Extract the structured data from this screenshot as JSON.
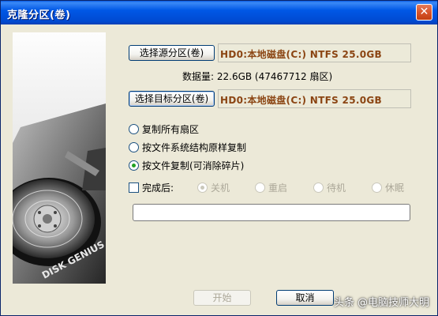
{
  "window": {
    "title": "克隆分区(卷)",
    "close_glyph": "✕"
  },
  "side_image": {
    "brand_text": "DISK GENIUS"
  },
  "source": {
    "button_label": "选择源分区(卷)",
    "drive": "HD0:本地磁盘(C:) NTFS 25.0GB"
  },
  "info": {
    "data_amount": "数据量: 22.6GB (47467712 扇区)"
  },
  "target": {
    "button_label": "选择目标分区(卷)",
    "drive": "HD0:本地磁盘(C:) NTFS 25.0GB"
  },
  "copy_modes": [
    {
      "label": "复制所有扇区",
      "checked": false
    },
    {
      "label": "按文件系统结构原样复制",
      "checked": false
    },
    {
      "label": "按文件复制(可消除碎片)",
      "checked": true
    }
  ],
  "after_done": {
    "label": "完成后:",
    "options": [
      {
        "label": "关机",
        "checked": true
      },
      {
        "label": "重启",
        "checked": false
      },
      {
        "label": "待机",
        "checked": false
      },
      {
        "label": "休眠",
        "checked": false
      }
    ]
  },
  "progress": {
    "fraction": 0
  },
  "footer": {
    "start_label": "开始",
    "cancel_label": "取消"
  },
  "watermark": "头条 @电脑技师大明"
}
